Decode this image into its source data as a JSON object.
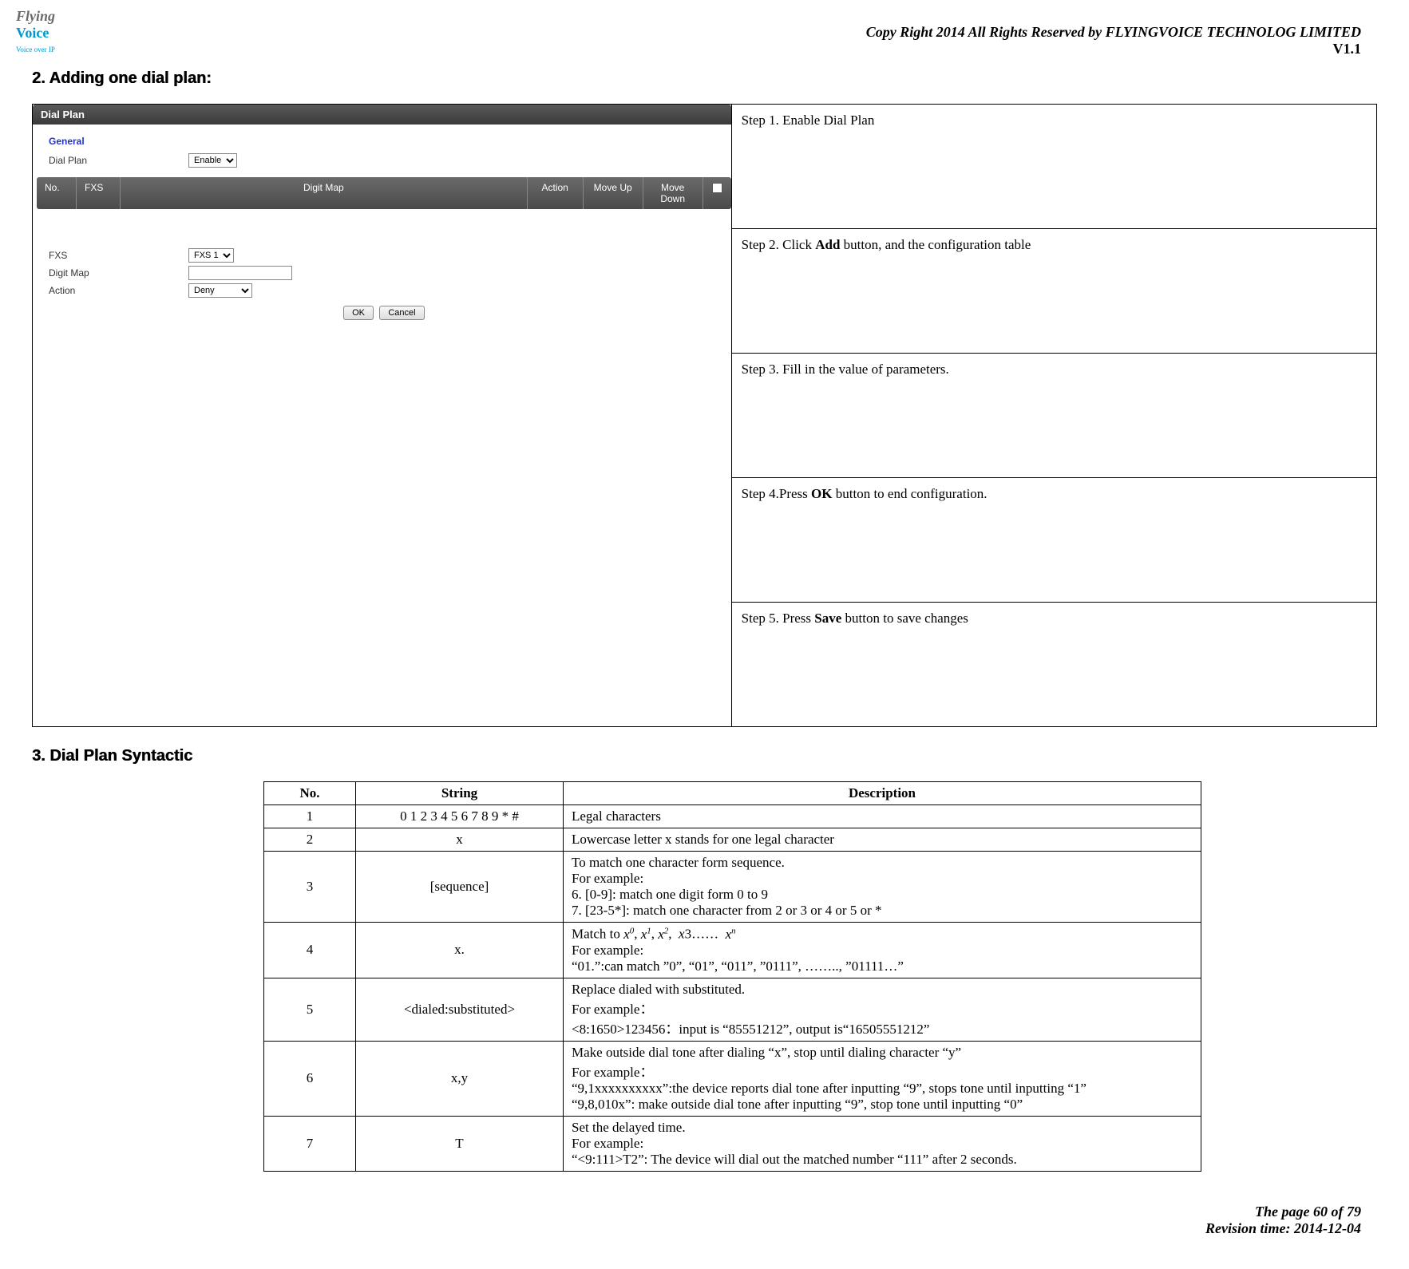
{
  "logo": {
    "line1": "Flying",
    "line2": "Voice",
    "sub": "Voice over IP"
  },
  "header": {
    "copyright": "Copy Right 2014 All Rights Reserved by FLYINGVOICE TECHNOLOG LIMITED",
    "version": "V1.1"
  },
  "section2_heading": "2.  Adding one dial plan:",
  "screenshot": {
    "title": "Dial Plan",
    "general_label": "General",
    "dialplan_label": "Dial Plan",
    "dialplan_value": "Enable",
    "grid": {
      "no": "No.",
      "fxs": "FXS",
      "digit": "Digit Map",
      "action": "Action",
      "moveup": "Move Up",
      "movedown": "Move Down"
    },
    "fxs_label": "FXS",
    "fxs_value": "FXS 1",
    "digitmap_label": "Digit Map",
    "action_label": "Action",
    "action_value": "Deny",
    "ok_btn": "OK",
    "cancel_btn": "Cancel"
  },
  "steps": {
    "s1": "Step 1. Enable Dial Plan",
    "s2_pre": "Step 2. Click ",
    "s2_bold": "Add",
    "s2_post": " button, and the configuration table",
    "s3": "Step 3. Fill in the value of parameters.",
    "s4_pre": "Step 4.Press ",
    "s4_bold": "OK",
    "s4_post": " button to end configuration.",
    "s5_pre": "Step 5. Press ",
    "s5_bold": "Save",
    "s5_post": " button to save changes"
  },
  "section3_heading": "3.  Dial Plan Syntactic",
  "syntax": {
    "headers": {
      "no": "No.",
      "string": "String",
      "desc": "Description"
    },
    "rows": {
      "r1": {
        "no": "1",
        "string": "0 1 2 3 4 5 6 7 8 9 * #",
        "desc": "Legal characters"
      },
      "r2": {
        "no": "2",
        "string": "x",
        "desc": "Lowercase letter x stands for one legal character"
      },
      "r3": {
        "no": "3",
        "string": "[sequence]",
        "desc_l1": "To match one character form sequence.",
        "desc_l2": "For example:",
        "desc_l3": "6.        [0-9]: match one digit form 0 to 9",
        "desc_l4": "7.        [23-5*]: match one character from 2 or 3 or 4 or 5 or *"
      },
      "r4": {
        "no": "4",
        "string": "x.",
        "desc_prefix": "Match to",
        "desc_mid": "……",
        "desc_l2": "For example:",
        "desc_l3": "“01.”:can match ”0”, “01”, “011”, ”0111”,    …….., ”01111…”"
      },
      "r5": {
        "no": "5",
        "string": "<dialed:substituted>",
        "desc_l1": "Replace dialed with substituted.",
        "desc_l2": "For example：",
        "desc_l3": "<8:1650>123456：input is “85551212”, output is“16505551212”"
      },
      "r6": {
        "no": "6",
        "string": "x,y",
        "desc_l1": "Make outside dial tone after dialing “x”, stop until dialing character “y”",
        "desc_l2": "For example：",
        "desc_l3": "“9,1xxxxxxxxxx”:the device reports dial tone after inputting “9”, stops tone until inputting “1”",
        "desc_l4": "“9,8,010x”: make outside dial tone after inputting “9”, stop tone until inputting “0”"
      },
      "r7": {
        "no": "7",
        "string": "T",
        "desc_l1": "Set the delayed time.",
        "desc_l2": "For example:",
        "desc_l3": "“<9:111>T2”: The device will dial out the matched number “111” after 2 seconds."
      }
    }
  },
  "footer": {
    "page": "The page 60 of 79",
    "rev": "Revision time: 2014-12-04"
  }
}
